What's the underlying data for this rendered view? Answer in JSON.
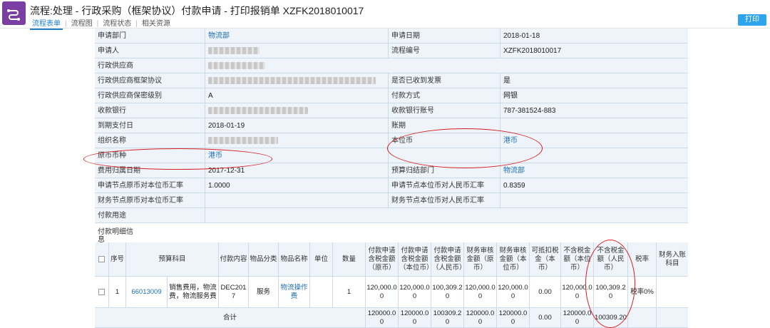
{
  "header": {
    "title": "流程:处理 - 行政采购（框架协议）付款申请 - 打印报销单 XZFK2018010017",
    "tabs": [
      "流程表单",
      "流程图",
      "流程状态",
      "相关资源"
    ],
    "print_label": "打印"
  },
  "form": {
    "rows": [
      {
        "l1": "申请部门",
        "v1": "物流部",
        "l2": "申请日期",
        "v2": "2018-01-18"
      },
      {
        "l1": "申请人",
        "v1": "",
        "l2": "流程编号",
        "v2": "XZFK2018010017"
      },
      {
        "l1": "行政供应商",
        "v1": ""
      },
      {
        "l1": "行政供应商框架协议",
        "v1": "",
        "l2": "是否已收到发票",
        "v2": "是"
      },
      {
        "l1": "行政供应商保密级别",
        "v1": "A",
        "l2": "付款方式",
        "v2": "网银"
      },
      {
        "l1": "收款银行",
        "v1": "",
        "l2": "收款银行账号",
        "v2": "787-381524-883"
      },
      {
        "l1": "到期支付日",
        "v1": "2018-01-19",
        "l2": "账期",
        "v2": ""
      },
      {
        "l1": "组织名称",
        "v1": "",
        "l2": "本位币",
        "v2": "港币"
      },
      {
        "l1": "原币币种",
        "v1": "港币",
        "l2": "",
        "v2": ""
      },
      {
        "l1": "费用归属日期",
        "v1": "2017-12-31",
        "l2": "预算归结部门",
        "v2": "物流部"
      },
      {
        "l1": "申请节点原币对本位币汇率",
        "v1": "1.0000",
        "l2": "申请节点本位币对人民币汇率",
        "v2": "0.8359"
      },
      {
        "l1": "财务节点原币对本位币汇率",
        "v1": "",
        "l2": "财务节点本位币对人民币汇率",
        "v2": ""
      },
      {
        "l1": "付款用途",
        "v1": ""
      }
    ],
    "detail_label": "付款明细信息"
  },
  "detail": {
    "headers": [
      "",
      "序号",
      "预算科目",
      "",
      "付款内容",
      "物品分类",
      "物品名称",
      "单位",
      "数量",
      "付款申请含税金额（原币）",
      "付款申请含税金额（本位币）",
      "付款申请含税金额（人民币）",
      "财务审核金额（原币）",
      "财务审核金额（本位币）",
      "可抵扣税金（本币）",
      "不含税金额（本位币）",
      "不含税金额（人民币）",
      "税率",
      "财务入账科目"
    ],
    "row": [
      "",
      "1",
      "66013009",
      "销售费用，物流费，物流服务费",
      "DEC2017",
      "服务",
      "物流操作费",
      "",
      "1",
      "120,000.00",
      "120,000.00",
      "100,309.20",
      "120,000.00",
      "120,000.00",
      "0.00",
      "120,000.00",
      "100,309.20",
      "税率0%",
      ""
    ],
    "total_label": "合计",
    "totals": [
      "120000.00",
      "120000.00",
      "100309.20",
      "120000.00",
      "120000.00",
      "0.00",
      "120000.00",
      "100309.20"
    ]
  }
}
